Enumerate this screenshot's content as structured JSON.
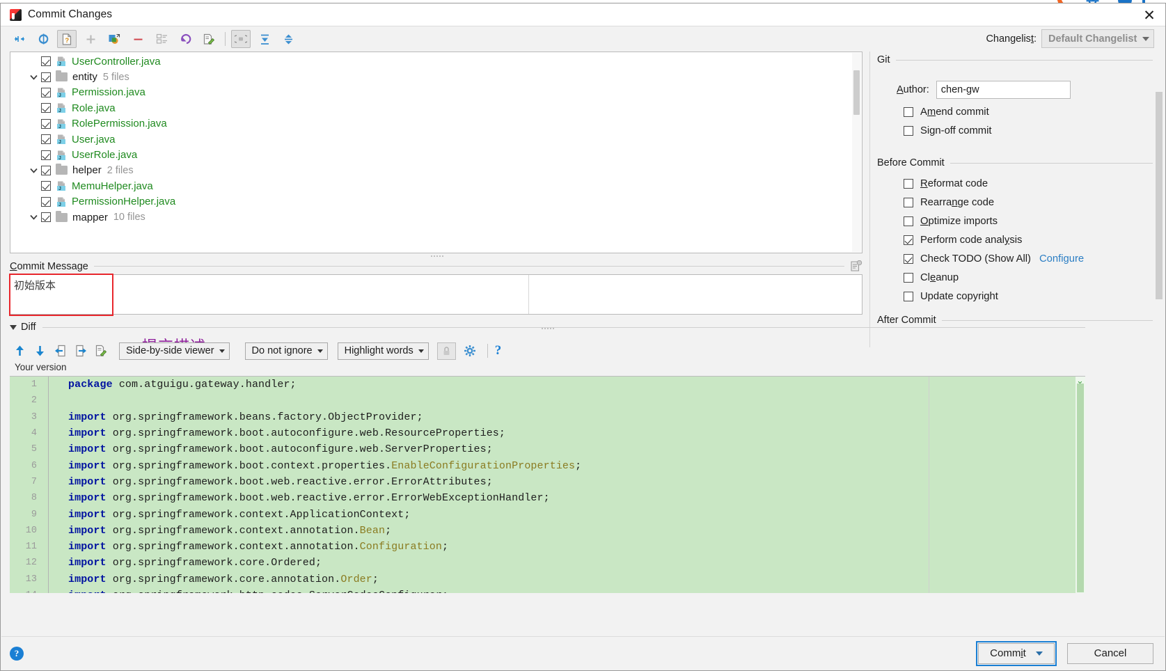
{
  "window": {
    "title": "Commit Changes",
    "icon": "intellij-idea-icon",
    "close_label": "✕"
  },
  "toolbar": {
    "buttons": [
      {
        "name": "collapse-to-changes-icon",
        "toggled": false
      },
      {
        "name": "refresh-icon",
        "toggled": false
      },
      {
        "name": "show-unversioned-files-icon",
        "toggled": true
      },
      {
        "name": "add-icon",
        "toggled": false
      },
      {
        "name": "show-diff-icon",
        "toggled": false
      },
      {
        "name": "delete-icon",
        "toggled": false
      },
      {
        "name": "group-by-icon",
        "toggled": false
      },
      {
        "name": "revert-icon",
        "toggled": false
      },
      {
        "name": "edit-source-icon",
        "toggled": false
      },
      {
        "name": "group-by-directory-icon",
        "toggled": true
      },
      {
        "name": "expand-all-icon",
        "toggled": false
      },
      {
        "name": "collapse-all-icon",
        "toggled": false
      }
    ],
    "changelist_label": "Changelist:",
    "changelist_label_pre": "Changelis",
    "changelist_label_underlined": "t",
    "changelist_label_post": ":",
    "changelist_value": "Default Changelist"
  },
  "tree": {
    "rows": [
      {
        "type": "file",
        "indent": 2,
        "name": "UserController.java",
        "checked": true
      },
      {
        "type": "folder",
        "indent": 1,
        "name": "entity",
        "count": "5 files",
        "checked": true,
        "expanded": true
      },
      {
        "type": "file",
        "indent": 2,
        "name": "Permission.java",
        "checked": true
      },
      {
        "type": "file",
        "indent": 2,
        "name": "Role.java",
        "checked": true
      },
      {
        "type": "file",
        "indent": 2,
        "name": "RolePermission.java",
        "checked": true
      },
      {
        "type": "file",
        "indent": 2,
        "name": "User.java",
        "checked": true
      },
      {
        "type": "file",
        "indent": 2,
        "name": "UserRole.java",
        "checked": true
      },
      {
        "type": "folder",
        "indent": 1,
        "name": "helper",
        "count": "2 files",
        "checked": true,
        "expanded": true
      },
      {
        "type": "file",
        "indent": 2,
        "name": "MemuHelper.java",
        "checked": true
      },
      {
        "type": "file",
        "indent": 2,
        "name": "PermissionHelper.java",
        "checked": true
      },
      {
        "type": "folder",
        "indent": 1,
        "name": "mapper",
        "count": "10 files",
        "checked": true,
        "expanded": true
      }
    ]
  },
  "commit_message": {
    "label_pre": "C",
    "label_underlined": "C",
    "label_rest": "ommit Message",
    "label": "Commit Message",
    "value": "初始版本",
    "annotation": "提交描述",
    "annotation_color": "#8e1f9b",
    "highlight_color": "#e8262c"
  },
  "options": {
    "git_section": "Git",
    "author_label": "Author:",
    "author_value": "chen-gw",
    "git_checkboxes": [
      {
        "label": "Amend commit",
        "checked": false,
        "mnemonic": "m"
      },
      {
        "label": "Sign-off commit",
        "checked": false,
        "mnemonic": "g"
      }
    ],
    "before_commit_section": "Before Commit",
    "before_commit": [
      {
        "label": "Reformat code",
        "checked": false,
        "mnemonic": "R"
      },
      {
        "label": "Rearrange code",
        "checked": false,
        "mnemonic": "n"
      },
      {
        "label": "Optimize imports",
        "checked": false,
        "mnemonic": "O"
      },
      {
        "label": "Perform code analysis",
        "checked": true,
        "mnemonic": "y"
      },
      {
        "label": "Check TODO (Show All)",
        "checked": true,
        "link": "Configure"
      },
      {
        "label": "Cleanup",
        "checked": false,
        "mnemonic": "e"
      },
      {
        "label": "Update copyright",
        "checked": false,
        "mnemonic": "g"
      }
    ],
    "after_commit_section": "After Commit",
    "link_color": "#2b7ec4"
  },
  "diff": {
    "section_title": "Diff",
    "nav_buttons": [
      {
        "name": "previous-difference-icon"
      },
      {
        "name": "next-difference-icon"
      },
      {
        "name": "accept-left-icon"
      },
      {
        "name": "accept-right-icon"
      },
      {
        "name": "edit-source-icon"
      }
    ],
    "viewer_mode": "Side-by-side viewer",
    "whitespace_mode": "Do not ignore",
    "highlight_mode": "Highlight words",
    "lock_icon": "lock-icon",
    "settings_icon": "gear-icon",
    "help_icon": "help-icon",
    "pane_label": "Your version",
    "background_color": "#c9e7c4",
    "lines": [
      {
        "no": "1",
        "segments": [
          {
            "t": "package",
            "c": "kw"
          },
          {
            "t": " com.atguigu.gateway.handler;",
            "c": ""
          }
        ]
      },
      {
        "no": "2",
        "segments": []
      },
      {
        "no": "3",
        "segments": [
          {
            "t": "import",
            "c": "kw"
          },
          {
            "t": " org.springframework.beans.factory.ObjectProvider;",
            "c": ""
          }
        ]
      },
      {
        "no": "4",
        "segments": [
          {
            "t": "import",
            "c": "kw"
          },
          {
            "t": " org.springframework.boot.autoconfigure.web.ResourceProperties;",
            "c": ""
          }
        ]
      },
      {
        "no": "5",
        "segments": [
          {
            "t": "import",
            "c": "kw"
          },
          {
            "t": " org.springframework.boot.autoconfigure.web.ServerProperties;",
            "c": ""
          }
        ]
      },
      {
        "no": "6",
        "segments": [
          {
            "t": "import",
            "c": "kw"
          },
          {
            "t": " org.springframework.boot.context.properties.",
            "c": ""
          },
          {
            "t": "EnableConfigurationProperties",
            "c": "ann"
          },
          {
            "t": ";",
            "c": ""
          }
        ]
      },
      {
        "no": "7",
        "segments": [
          {
            "t": "import",
            "c": "kw"
          },
          {
            "t": " org.springframework.boot.web.reactive.error.ErrorAttributes;",
            "c": ""
          }
        ]
      },
      {
        "no": "8",
        "segments": [
          {
            "t": "import",
            "c": "kw"
          },
          {
            "t": " org.springframework.boot.web.reactive.error.ErrorWebExceptionHandler;",
            "c": ""
          }
        ]
      },
      {
        "no": "9",
        "segments": [
          {
            "t": "import",
            "c": "kw"
          },
          {
            "t": " org.springframework.context.ApplicationContext;",
            "c": ""
          }
        ]
      },
      {
        "no": "10",
        "segments": [
          {
            "t": "import",
            "c": "kw"
          },
          {
            "t": " org.springframework.context.annotation.",
            "c": ""
          },
          {
            "t": "Bean",
            "c": "ann"
          },
          {
            "t": ";",
            "c": ""
          }
        ]
      },
      {
        "no": "11",
        "segments": [
          {
            "t": "import",
            "c": "kw"
          },
          {
            "t": " org.springframework.context.annotation.",
            "c": ""
          },
          {
            "t": "Configuration",
            "c": "ann"
          },
          {
            "t": ";",
            "c": ""
          }
        ]
      },
      {
        "no": "12",
        "segments": [
          {
            "t": "import",
            "c": "kw"
          },
          {
            "t": " org.springframework.core.Ordered;",
            "c": ""
          }
        ]
      },
      {
        "no": "13",
        "segments": [
          {
            "t": "import",
            "c": "kw"
          },
          {
            "t": " org.springframework.core.annotation.",
            "c": ""
          },
          {
            "t": "Order",
            "c": "ann"
          },
          {
            "t": ";",
            "c": ""
          }
        ]
      },
      {
        "no": "14",
        "segments": [
          {
            "t": "import",
            "c": "kw"
          },
          {
            "t": " org.springframework.http.codec.ServerCodecConfigurer;",
            "c": ""
          }
        ]
      }
    ]
  },
  "footer": {
    "help_label": "?",
    "commit_label": "Commit",
    "commit_mnemonic": "i",
    "cancel_label": "Cancel",
    "focus_color": "#1a7fd4"
  }
}
